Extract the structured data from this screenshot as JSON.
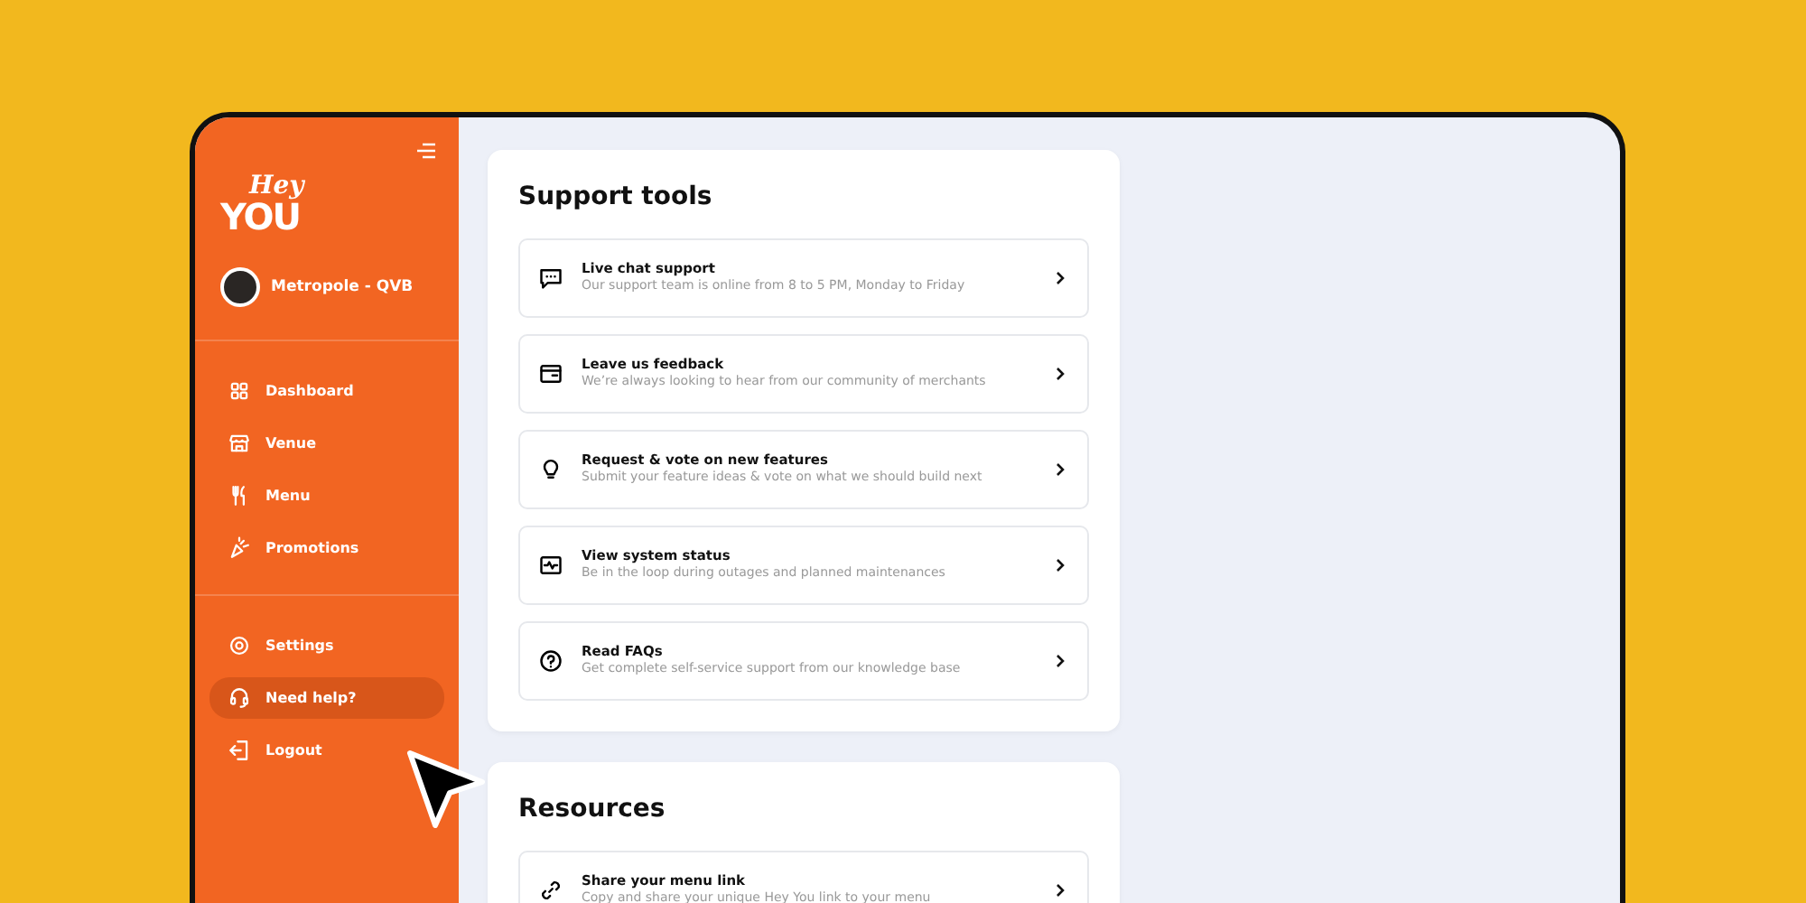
{
  "logo": {
    "line_1": "Hey",
    "line_2": "YOU"
  },
  "venue": {
    "name": "Metropole - QVB"
  },
  "nav_main": [
    {
      "label": "Dashboard",
      "kind": "grid",
      "selected": false
    },
    {
      "label": "Venue",
      "kind": "store",
      "selected": false
    },
    {
      "label": "Menu",
      "kind": "cutlery",
      "selected": false
    },
    {
      "label": "Promotions",
      "kind": "party",
      "selected": false
    }
  ],
  "nav_bottom": [
    {
      "label": "Settings",
      "kind": "gear",
      "selected": false
    },
    {
      "label": "Need help?",
      "kind": "headset",
      "selected": true
    },
    {
      "label": "Logout",
      "kind": "logout",
      "selected": false
    }
  ],
  "sections": [
    {
      "title": "Support tools",
      "items": [
        {
          "kind": "chat",
          "title": "Live chat support",
          "subtitle": "Our support team is online from 8 to 5 PM, Monday to Friday"
        },
        {
          "kind": "card",
          "title": "Leave us feedback",
          "subtitle": "We’re always looking to hear from our community of merchants"
        },
        {
          "kind": "bulb",
          "title": "Request & vote on new features",
          "subtitle": "Submit your feature ideas & vote on what we should build next"
        },
        {
          "kind": "pulse",
          "title": "View system status",
          "subtitle": "Be in the loop during outages and planned maintenances"
        },
        {
          "kind": "question",
          "title": "Read FAQs",
          "subtitle": "Get complete self-service support from our knowledge base"
        }
      ]
    },
    {
      "title": "Resources",
      "items": [
        {
          "kind": "link",
          "title": "Share your menu link",
          "subtitle": "Copy and share your unique Hey You link to your menu"
        }
      ]
    }
  ]
}
